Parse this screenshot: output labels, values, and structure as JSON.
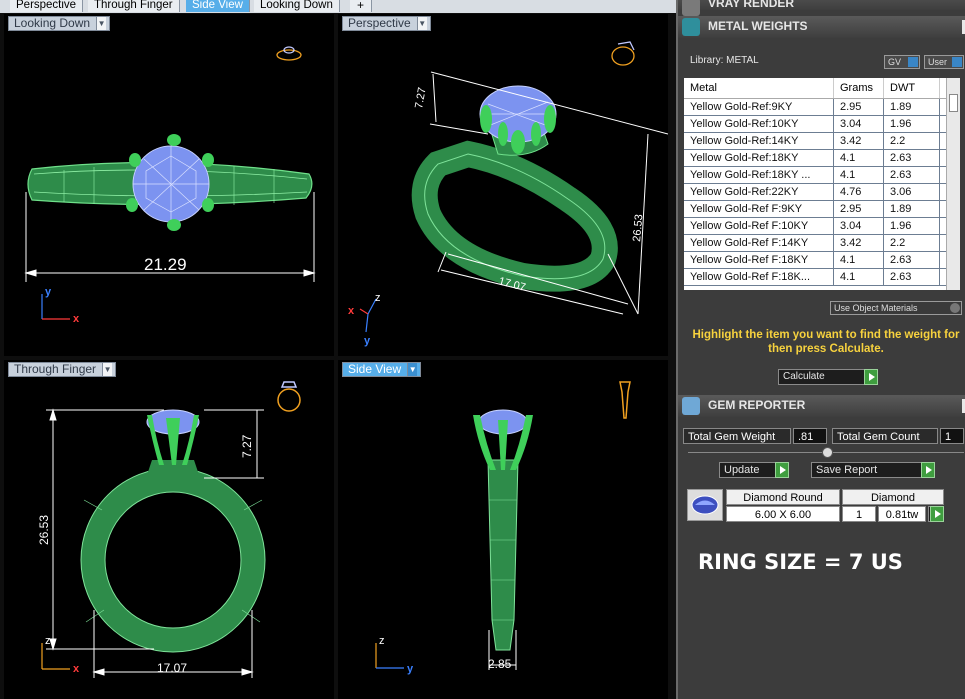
{
  "tabs": [
    {
      "label": "Perspective",
      "active": false
    },
    {
      "label": "Through Finger",
      "active": false
    },
    {
      "label": "Side View",
      "active": true
    },
    {
      "label": "Looking Down",
      "active": false
    }
  ],
  "add_tab_label": "+",
  "viewports": {
    "looking_down": {
      "label": "Looking Down",
      "dimension": "21.29",
      "axis_x": "x",
      "axis_y": "y"
    },
    "perspective": {
      "label": "Perspective",
      "dim_prong": "7.27",
      "dim_width": "17.07",
      "dim_height": "26.53",
      "axis_x": "x",
      "axis_y": "y",
      "axis_z": "z"
    },
    "through_finger": {
      "label": "Through Finger",
      "dim_height": "26.53",
      "dim_prong": "7.27",
      "dim_width": "17.07",
      "axis_x": "x",
      "axis_z": "z"
    },
    "side_view": {
      "label": "Side View",
      "dimension": "2.85",
      "axis_y": "y",
      "axis_z": "z"
    }
  },
  "panel": {
    "vray_title": "VRAY RENDER",
    "metal_title": "METAL WEIGHTS",
    "library_label": "Library: METAL",
    "gv_label": "GV",
    "user_label": "User",
    "columns": [
      "Metal",
      "Grams",
      "DWT"
    ],
    "rows": [
      [
        "Yellow Gold-Ref:9KY",
        "2.95",
        "1.89"
      ],
      [
        "Yellow Gold-Ref:10KY",
        "3.04",
        "1.96"
      ],
      [
        "Yellow Gold-Ref:14KY",
        "3.42",
        "2.2"
      ],
      [
        "Yellow Gold-Ref:18KY",
        "4.1",
        "2.63"
      ],
      [
        "Yellow Gold-Ref:18KY ...",
        "4.1",
        "2.63"
      ],
      [
        "Yellow Gold-Ref:22KY",
        "4.76",
        "3.06"
      ],
      [
        "Yellow Gold-Ref F:9KY",
        "2.95",
        "1.89"
      ],
      [
        "Yellow Gold-Ref F:10KY",
        "3.04",
        "1.96"
      ],
      [
        "Yellow Gold-Ref F:14KY",
        "3.42",
        "2.2"
      ],
      [
        "Yellow Gold-Ref F:18KY",
        "4.1",
        "2.63"
      ],
      [
        "Yellow Gold-Ref F:18K...",
        "4.1",
        "2.63"
      ]
    ],
    "use_object_materials": "Use Object Materials",
    "hint": "Highlight the item you want to find the weight for then press Calculate.",
    "calculate_label": "Calculate",
    "gem_title": "GEM REPORTER",
    "total_gem_weight_label": "Total Gem Weight",
    "total_gem_weight_value": ".81",
    "total_gem_count_label": "Total Gem Count",
    "total_gem_count_value": "1",
    "update_label": "Update",
    "save_report_label": "Save Report",
    "gem_shape": "Diamond Round",
    "gem_type": "Diamond",
    "gem_size": "6.00 X 6.00",
    "gem_qty": "1",
    "gem_tw": "0.81tw",
    "ring_size": "RING SIZE = 7 US"
  },
  "colors": {
    "metal": "#5fd37f",
    "gem": "#8fa6ff",
    "accent": "#57aee9",
    "hint": "#f7d23e"
  }
}
